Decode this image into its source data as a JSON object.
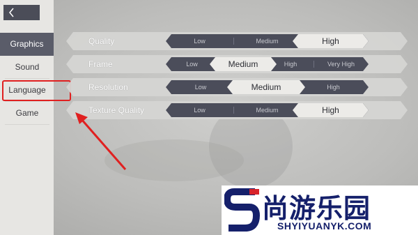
{
  "back_button": {
    "icon": "chevron-left-icon"
  },
  "sidebar": {
    "items": [
      {
        "label": "Graphics",
        "active": true
      },
      {
        "label": "Sound",
        "active": false
      },
      {
        "label": "Language",
        "active": false
      },
      {
        "label": "Game",
        "active": false
      }
    ]
  },
  "settings": {
    "quality": {
      "label": "Quality",
      "options": [
        "Low",
        "Medium",
        "High"
      ],
      "selected": "High"
    },
    "frame": {
      "label": "Frame",
      "options": [
        "Low",
        "Medium",
        "High",
        "Very High"
      ],
      "selected": "Medium"
    },
    "resolution": {
      "label": "Resolution",
      "options": [
        "Low",
        "Medium",
        "High"
      ],
      "selected": "Medium"
    },
    "texture_quality": {
      "label": "Texture Quality",
      "options": [
        "Low",
        "Medium",
        "High"
      ],
      "selected": "High"
    }
  },
  "watermark": {
    "name": "尚游乐园",
    "url": "SHYIYUANYK.COM"
  },
  "colors": {
    "annotation": "#e02020",
    "accent_dark": "#4b4d5a",
    "watermark_blue": "#15206b",
    "watermark_red": "#d8232a"
  }
}
